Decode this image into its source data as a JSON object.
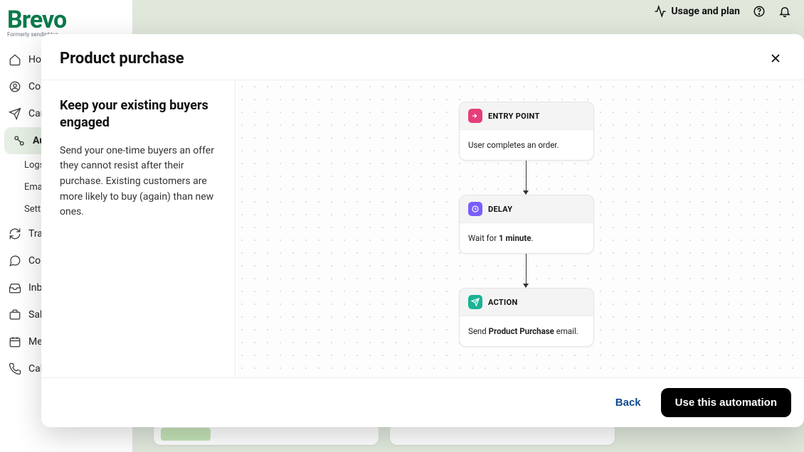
{
  "app": {
    "logo_text": "Brevo",
    "logo_subtext": "Formerly sendinblue"
  },
  "topbar": {
    "usage_label": "Usage and plan"
  },
  "sidebar": {
    "items": [
      {
        "label": "Home"
      },
      {
        "label": "Contacts"
      },
      {
        "label": "Campaigns"
      },
      {
        "label": "Automations"
      },
      {
        "label": "Transactional"
      },
      {
        "label": "Conversations"
      },
      {
        "label": "Inbox"
      },
      {
        "label": "Sales CRM"
      },
      {
        "label": "Meetings"
      },
      {
        "label": "Calls"
      }
    ],
    "sub_items": [
      {
        "label": "Logs"
      },
      {
        "label": "Email Templates"
      },
      {
        "label": "Settings"
      }
    ]
  },
  "modal": {
    "title": "Product purchase",
    "left": {
      "heading": "Keep your existing buyers engaged",
      "description": "Send your one-time buyers an offer they cannot resist after their purchase. Existing customers are more likely to buy (again) than new ones."
    },
    "flow": {
      "entry": {
        "title": "ENTRY POINT",
        "body": "User completes an order."
      },
      "delay": {
        "title": "DELAY",
        "body_prefix": "Wait for ",
        "body_bold": "1 minute",
        "body_suffix": "."
      },
      "action": {
        "title": "ACTION",
        "body_prefix": "Send ",
        "body_bold": "Product Purchase",
        "body_suffix": " email."
      }
    },
    "footer": {
      "back_label": "Back",
      "primary_label": "Use this automation"
    }
  }
}
